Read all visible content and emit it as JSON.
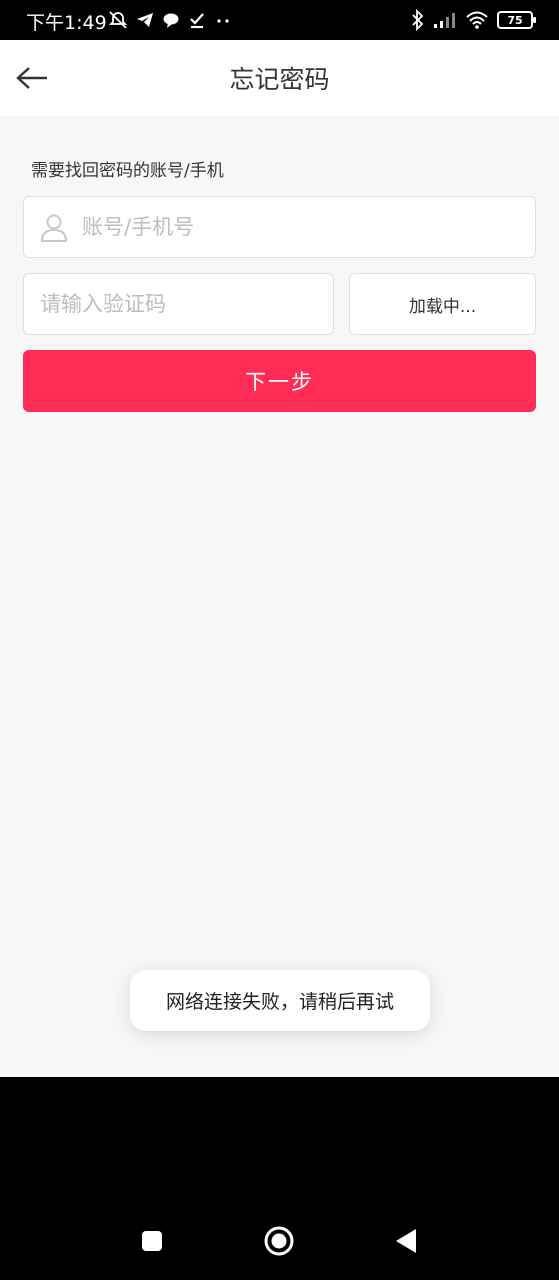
{
  "status_bar": {
    "time": "下午1:49",
    "battery": "75",
    "icons_left": [
      "alarm-off-icon",
      "telegram-icon",
      "chat-bubble-icon",
      "download-done-icon",
      "more-dots-icon"
    ],
    "icons_right": [
      "bluetooth-icon",
      "signal-icon",
      "wifi-icon",
      "battery-icon"
    ]
  },
  "header": {
    "title": "忘记密码",
    "back_icon": "arrow-left-icon"
  },
  "form": {
    "section_label": "需要找回密码的账号/手机",
    "account_placeholder": "账号/手机号",
    "account_value": "",
    "code_placeholder": "请输入验证码",
    "code_value": "",
    "get_code_label": "加载中...",
    "next_label": "下一步"
  },
  "toast": {
    "message": "网络连接失败，请稍后再试"
  },
  "colors": {
    "accent": "#ff2d55",
    "background": "#f7f7f7",
    "border": "#dedede",
    "placeholder": "#bdbdbd"
  },
  "nav_bar": {
    "buttons": [
      "recent-apps-icon",
      "home-icon",
      "back-triangle-icon"
    ]
  }
}
